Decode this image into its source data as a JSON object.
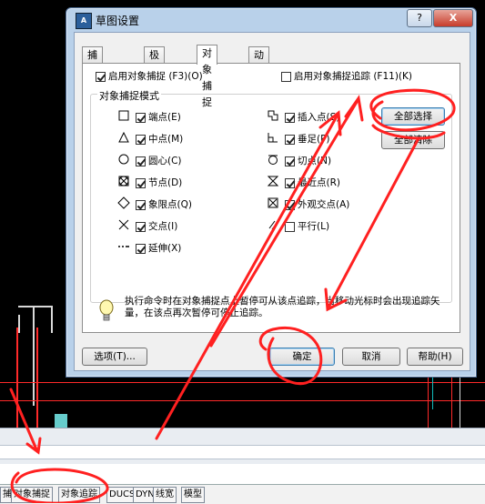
{
  "dialog": {
    "title": "草图设置",
    "help_glyph": "?",
    "close_glyph": "X",
    "tabs": [
      {
        "label": "捕捉和栅格",
        "active": false
      },
      {
        "label": "极轴追踪",
        "active": false
      },
      {
        "label": "对象捕捉",
        "active": true
      },
      {
        "label": "动态输入",
        "active": false
      }
    ],
    "enable_osnap": {
      "label": "启用对象捕捉 (F3)(O)",
      "checked": true
    },
    "enable_tracking": {
      "label": "启用对象捕捉追踪 (F11)(K)",
      "checked": false
    },
    "group_title": "对象捕捉模式",
    "left_modes": [
      {
        "label": "端点(E)",
        "checked": true,
        "icon": "square-endpoint-icon"
      },
      {
        "label": "中点(M)",
        "checked": true,
        "icon": "triangle-midpoint-icon"
      },
      {
        "label": "圆心(C)",
        "checked": true,
        "icon": "circle-center-icon"
      },
      {
        "label": "节点(D)",
        "checked": true,
        "icon": "node-icon"
      },
      {
        "label": "象限点(Q)",
        "checked": true,
        "icon": "diamond-quadrant-icon"
      },
      {
        "label": "交点(I)",
        "checked": true,
        "icon": "x-intersection-icon"
      },
      {
        "label": "延伸(X)",
        "checked": true,
        "icon": "extension-icon"
      }
    ],
    "right_modes": [
      {
        "label": "插入点(S)",
        "checked": true,
        "icon": "insertion-icon"
      },
      {
        "label": "垂足(P)",
        "checked": true,
        "icon": "perpendicular-icon"
      },
      {
        "label": "切点(N)",
        "checked": true,
        "icon": "tangent-icon"
      },
      {
        "label": "最近点(R)",
        "checked": true,
        "icon": "nearest-icon"
      },
      {
        "label": "外观交点(A)",
        "checked": true,
        "icon": "apparent-intersection-icon"
      },
      {
        "label": "平行(L)",
        "checked": false,
        "icon": "parallel-icon"
      }
    ],
    "select_all": "全部选择",
    "clear_all": "全部清除",
    "info_text": "执行命令时在对象捕捉点上暂停可从该点追踪，当移动光标时会出现追踪矢量，在该点再次暂停可停止追踪。",
    "options_button": "选项(T)...",
    "ok_button": "确定",
    "cancel_button": "取消",
    "help_button": "帮助(H)"
  },
  "statusbar": {
    "buttons": [
      "捕",
      "对象捕捉",
      "对象追踪",
      "DUCS",
      "DYN",
      "线宽",
      "模型"
    ]
  },
  "colors": {
    "annotation": "#ff2020",
    "cad_line": "#ff2a2a"
  }
}
